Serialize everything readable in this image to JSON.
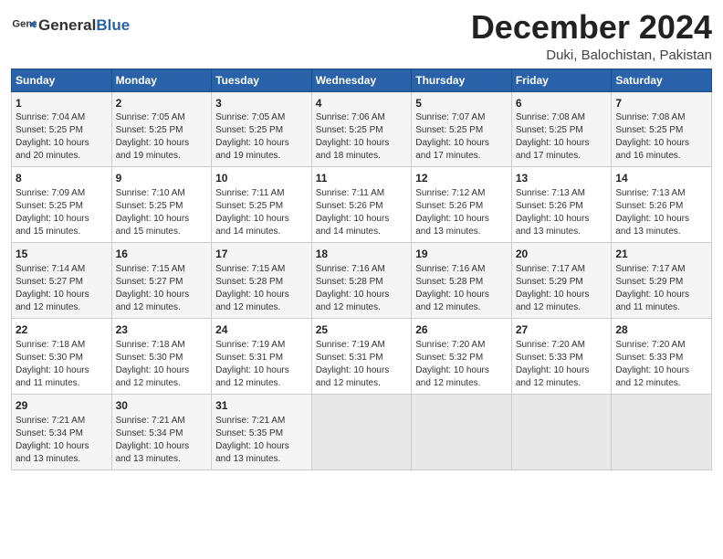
{
  "header": {
    "logo_line1": "General",
    "logo_line2": "Blue",
    "month_title": "December 2024",
    "location": "Duki, Balochistan, Pakistan"
  },
  "calendar": {
    "weekdays": [
      "Sunday",
      "Monday",
      "Tuesday",
      "Wednesday",
      "Thursday",
      "Friday",
      "Saturday"
    ],
    "weeks": [
      [
        {
          "day": "1",
          "info": "Sunrise: 7:04 AM\nSunset: 5:25 PM\nDaylight: 10 hours\nand 20 minutes."
        },
        {
          "day": "2",
          "info": "Sunrise: 7:05 AM\nSunset: 5:25 PM\nDaylight: 10 hours\nand 19 minutes."
        },
        {
          "day": "3",
          "info": "Sunrise: 7:05 AM\nSunset: 5:25 PM\nDaylight: 10 hours\nand 19 minutes."
        },
        {
          "day": "4",
          "info": "Sunrise: 7:06 AM\nSunset: 5:25 PM\nDaylight: 10 hours\nand 18 minutes."
        },
        {
          "day": "5",
          "info": "Sunrise: 7:07 AM\nSunset: 5:25 PM\nDaylight: 10 hours\nand 17 minutes."
        },
        {
          "day": "6",
          "info": "Sunrise: 7:08 AM\nSunset: 5:25 PM\nDaylight: 10 hours\nand 17 minutes."
        },
        {
          "day": "7",
          "info": "Sunrise: 7:08 AM\nSunset: 5:25 PM\nDaylight: 10 hours\nand 16 minutes."
        }
      ],
      [
        {
          "day": "8",
          "info": "Sunrise: 7:09 AM\nSunset: 5:25 PM\nDaylight: 10 hours\nand 15 minutes."
        },
        {
          "day": "9",
          "info": "Sunrise: 7:10 AM\nSunset: 5:25 PM\nDaylight: 10 hours\nand 15 minutes."
        },
        {
          "day": "10",
          "info": "Sunrise: 7:11 AM\nSunset: 5:25 PM\nDaylight: 10 hours\nand 14 minutes."
        },
        {
          "day": "11",
          "info": "Sunrise: 7:11 AM\nSunset: 5:26 PM\nDaylight: 10 hours\nand 14 minutes."
        },
        {
          "day": "12",
          "info": "Sunrise: 7:12 AM\nSunset: 5:26 PM\nDaylight: 10 hours\nand 13 minutes."
        },
        {
          "day": "13",
          "info": "Sunrise: 7:13 AM\nSunset: 5:26 PM\nDaylight: 10 hours\nand 13 minutes."
        },
        {
          "day": "14",
          "info": "Sunrise: 7:13 AM\nSunset: 5:26 PM\nDaylight: 10 hours\nand 13 minutes."
        }
      ],
      [
        {
          "day": "15",
          "info": "Sunrise: 7:14 AM\nSunset: 5:27 PM\nDaylight: 10 hours\nand 12 minutes."
        },
        {
          "day": "16",
          "info": "Sunrise: 7:15 AM\nSunset: 5:27 PM\nDaylight: 10 hours\nand 12 minutes."
        },
        {
          "day": "17",
          "info": "Sunrise: 7:15 AM\nSunset: 5:28 PM\nDaylight: 10 hours\nand 12 minutes."
        },
        {
          "day": "18",
          "info": "Sunrise: 7:16 AM\nSunset: 5:28 PM\nDaylight: 10 hours\nand 12 minutes."
        },
        {
          "day": "19",
          "info": "Sunrise: 7:16 AM\nSunset: 5:28 PM\nDaylight: 10 hours\nand 12 minutes."
        },
        {
          "day": "20",
          "info": "Sunrise: 7:17 AM\nSunset: 5:29 PM\nDaylight: 10 hours\nand 12 minutes."
        },
        {
          "day": "21",
          "info": "Sunrise: 7:17 AM\nSunset: 5:29 PM\nDaylight: 10 hours\nand 11 minutes."
        }
      ],
      [
        {
          "day": "22",
          "info": "Sunrise: 7:18 AM\nSunset: 5:30 PM\nDaylight: 10 hours\nand 11 minutes."
        },
        {
          "day": "23",
          "info": "Sunrise: 7:18 AM\nSunset: 5:30 PM\nDaylight: 10 hours\nand 12 minutes."
        },
        {
          "day": "24",
          "info": "Sunrise: 7:19 AM\nSunset: 5:31 PM\nDaylight: 10 hours\nand 12 minutes."
        },
        {
          "day": "25",
          "info": "Sunrise: 7:19 AM\nSunset: 5:31 PM\nDaylight: 10 hours\nand 12 minutes."
        },
        {
          "day": "26",
          "info": "Sunrise: 7:20 AM\nSunset: 5:32 PM\nDaylight: 10 hours\nand 12 minutes."
        },
        {
          "day": "27",
          "info": "Sunrise: 7:20 AM\nSunset: 5:33 PM\nDaylight: 10 hours\nand 12 minutes."
        },
        {
          "day": "28",
          "info": "Sunrise: 7:20 AM\nSunset: 5:33 PM\nDaylight: 10 hours\nand 12 minutes."
        }
      ],
      [
        {
          "day": "29",
          "info": "Sunrise: 7:21 AM\nSunset: 5:34 PM\nDaylight: 10 hours\nand 13 minutes."
        },
        {
          "day": "30",
          "info": "Sunrise: 7:21 AM\nSunset: 5:34 PM\nDaylight: 10 hours\nand 13 minutes."
        },
        {
          "day": "31",
          "info": "Sunrise: 7:21 AM\nSunset: 5:35 PM\nDaylight: 10 hours\nand 13 minutes."
        },
        {
          "day": "",
          "info": ""
        },
        {
          "day": "",
          "info": ""
        },
        {
          "day": "",
          "info": ""
        },
        {
          "day": "",
          "info": ""
        }
      ]
    ]
  }
}
